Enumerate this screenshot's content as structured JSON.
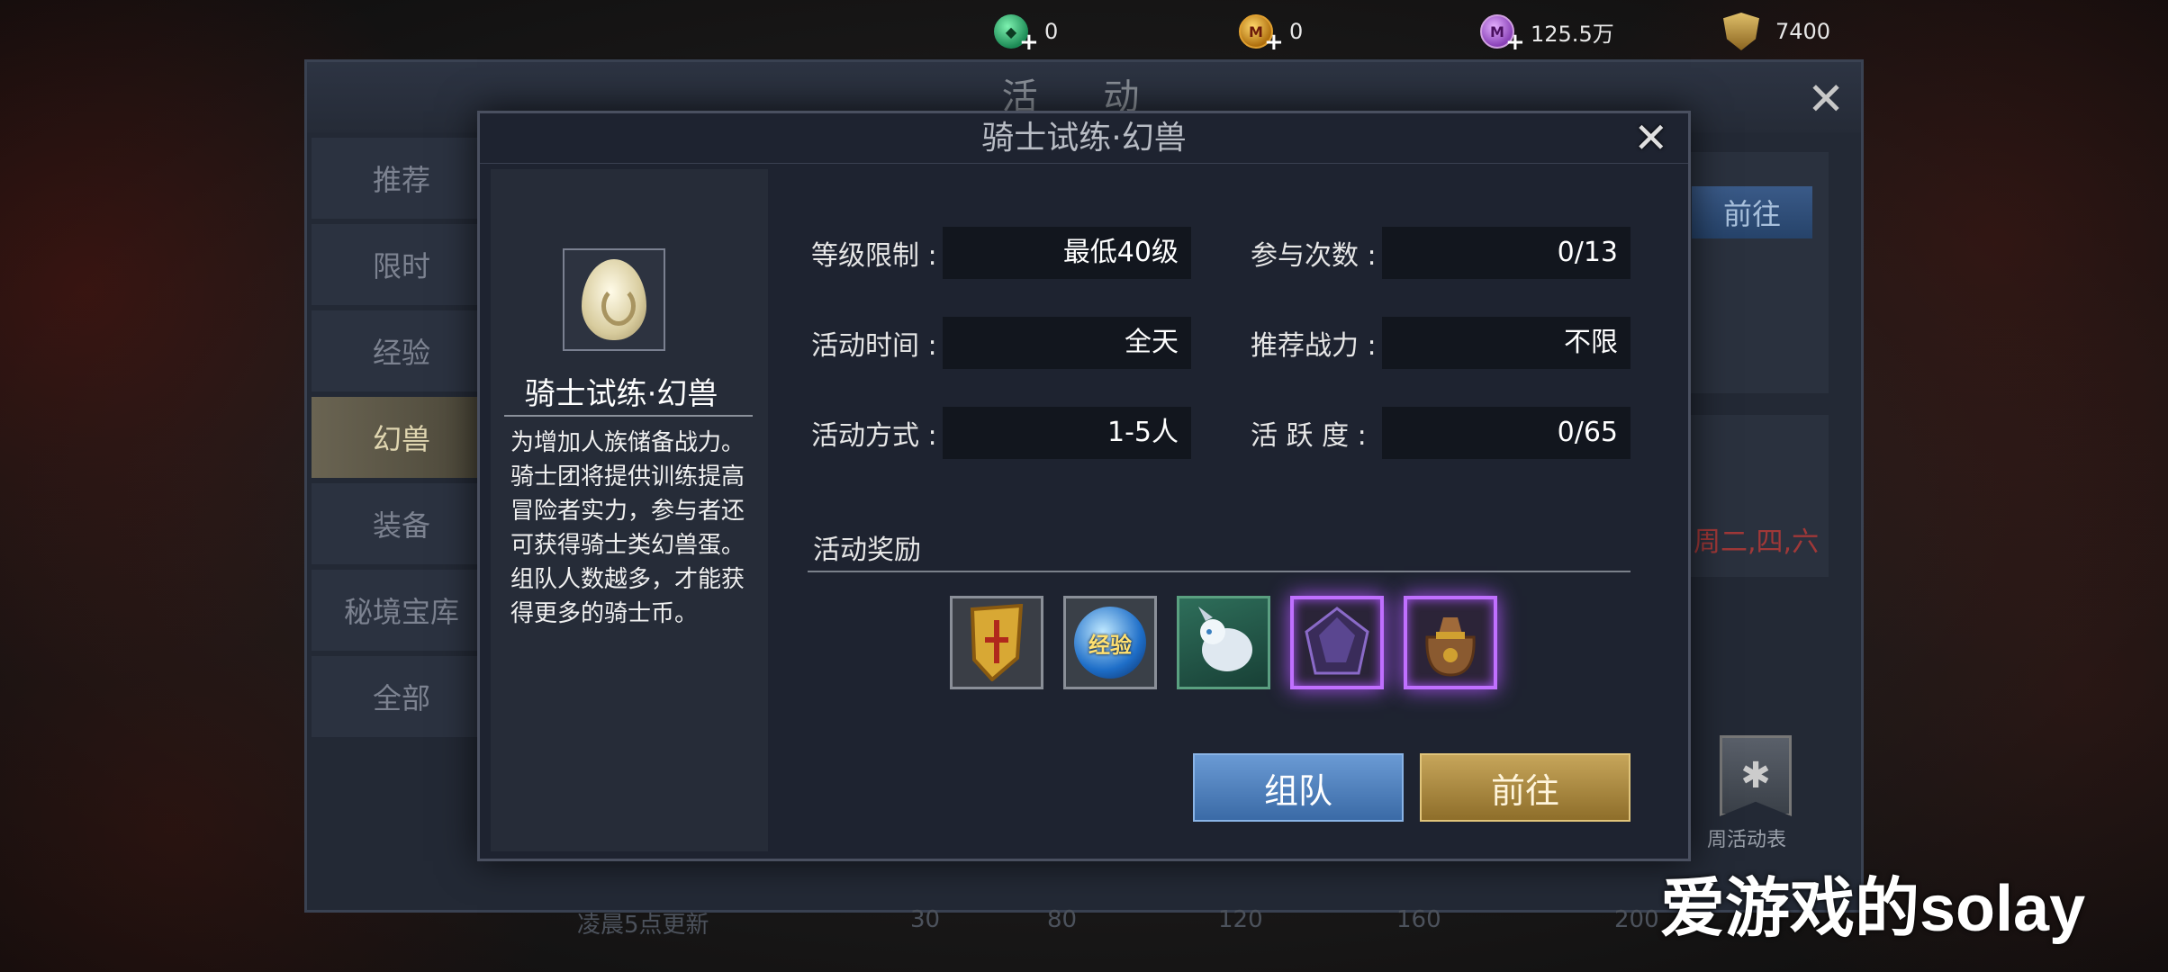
{
  "currencies": [
    {
      "icon": "green-gem-icon",
      "value": "0"
    },
    {
      "icon": "gold-coin-icon",
      "value": "0"
    },
    {
      "icon": "purple-coin-icon",
      "value": "125.5万"
    },
    {
      "icon": "shield-power-icon",
      "value": "7400"
    }
  ],
  "plus_glyph": "+",
  "background_panel": {
    "title": "活 动",
    "close_glyph": "✕",
    "tabs": [
      "推荐",
      "限时",
      "经验",
      "幻兽",
      "装备",
      "秘境宝库",
      "全部"
    ],
    "active_tab": "幻兽",
    "go_label": "前往",
    "schedule_text": "周二,四,六",
    "weekly_label": "周活动表",
    "refresh_text": "凌晨5点更新",
    "activity_marks": [
      "30",
      "80",
      "120",
      "160",
      "200"
    ]
  },
  "modal": {
    "title": "骑士试练·幻兽",
    "close_glyph": "✕",
    "name": "骑士试练·幻兽",
    "icon": "beast-egg-icon",
    "description": "为增加人族储备战力。\n骑士团将提供训练提高\n冒险者实力，参与者还\n可获得骑士类幻兽蛋。\n组队人数越多，才能获\n得更多的骑士币。",
    "fields": [
      {
        "label": "等级限制 :",
        "value": "最低40级"
      },
      {
        "label": "参与次数 :",
        "value": "0/13"
      },
      {
        "label": "活动时间 :",
        "value": "全天"
      },
      {
        "label": "推荐战力 :",
        "value": "不限"
      },
      {
        "label": "活动方式 :",
        "value": "1-5人"
      },
      {
        "label": "活 跃 度 :",
        "value": "0/65"
      }
    ],
    "reward_title": "活动奖励",
    "rewards": [
      {
        "icon": "golden-shield-icon",
        "rarity": "normal"
      },
      {
        "icon": "exp-orb-icon",
        "rarity": "normal",
        "label": "经验"
      },
      {
        "icon": "white-beast-icon",
        "rarity": "normal"
      },
      {
        "icon": "dark-crystal-icon",
        "rarity": "epic"
      },
      {
        "icon": "treasure-bag-icon",
        "rarity": "epic"
      }
    ],
    "team_button": "组队",
    "go_button": "前往"
  },
  "watermark": "爱游戏的solay",
  "colors": {
    "accent_gold": "#c6a55a",
    "accent_blue": "#4a7ab8",
    "epic_purple": "#c070ff"
  }
}
